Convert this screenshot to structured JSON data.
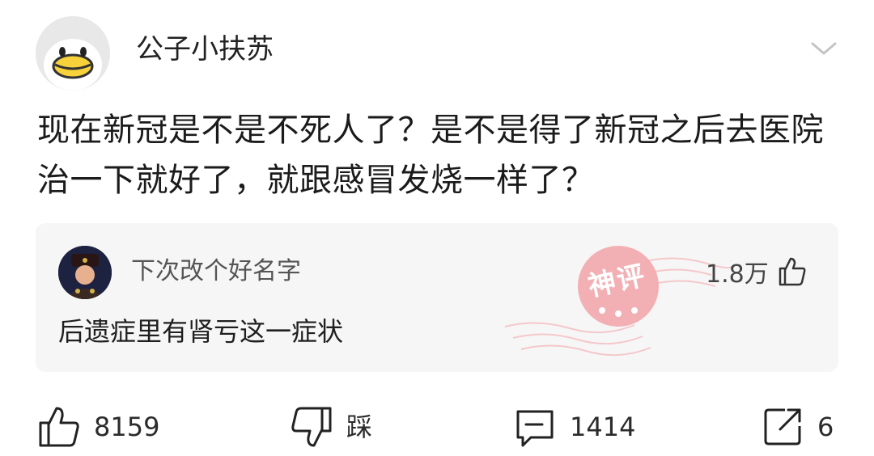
{
  "post": {
    "username": "公子小扶苏",
    "text": "现在新冠是不是不死人了？是不是得了新冠之后去医院治一下就好了，就跟感冒发烧一样了？"
  },
  "top_comment": {
    "username": "下次改个好名字",
    "text": "后遗症里有肾亏这一症状",
    "likes": "1.8万",
    "badge": "神评"
  },
  "actions": {
    "like_count": "8159",
    "dislike_label": "踩",
    "comment_count": "1414",
    "share_count": "6"
  },
  "icons": [
    "avatar",
    "chevron-down-icon",
    "thumbs-up-icon",
    "thumbs-down-icon",
    "comment-icon",
    "share-icon"
  ],
  "colors": {
    "stamp": "#f2a6aa",
    "card_bg": "#f6f6f6",
    "text": "#1f1f1f"
  }
}
